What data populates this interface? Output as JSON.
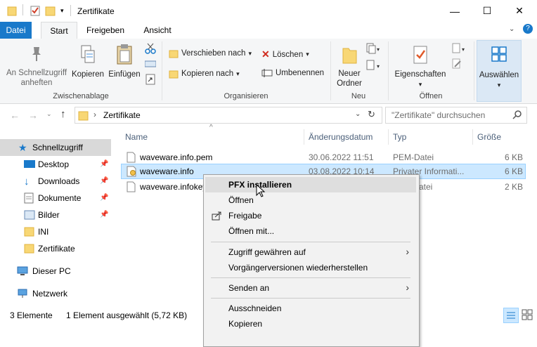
{
  "window": {
    "title": "Zertifikate",
    "minimize_glyph": "—",
    "maximize_glyph": "☐",
    "close_glyph": "✕"
  },
  "tabs": {
    "file": "Datei",
    "start": "Start",
    "share": "Freigeben",
    "view": "Ansicht"
  },
  "ribbon": {
    "quick_access_pin": "An Schnellzugriff anheften",
    "copy": "Kopieren",
    "paste": "Einfügen",
    "clipboard_group": "Zwischenablage",
    "move_to": "Verschieben nach",
    "copy_to": "Kopieren nach",
    "delete": "Löschen",
    "rename": "Umbenennen",
    "organize_group": "Organisieren",
    "new_folder": "Neuer Ordner",
    "new_group": "Neu",
    "properties": "Eigenschaften",
    "open_group": "Öffnen",
    "select": "Auswählen"
  },
  "address": {
    "path": "Zertifikate",
    "search_placeholder": "\"Zertifikate\" durchsuchen"
  },
  "nav": {
    "items": [
      {
        "label": "Schnellzugriff"
      },
      {
        "label": "Desktop"
      },
      {
        "label": "Downloads"
      },
      {
        "label": "Dokumente"
      },
      {
        "label": "Bilder"
      },
      {
        "label": "INI"
      },
      {
        "label": "Zertifikate"
      },
      {
        "label": "Dieser PC"
      },
      {
        "label": "Netzwerk"
      }
    ]
  },
  "columns": {
    "name": "Name",
    "date": "Änderungsdatum",
    "type": "Typ",
    "size": "Größe"
  },
  "files": [
    {
      "name": "waveware.info.pem",
      "date": "30.06.2022 11:51",
      "type": "PEM-Datei",
      "size": "6 KB"
    },
    {
      "name": "waveware.info",
      "date": "03.08.2022 10:14",
      "type": "Privater Informati...",
      "size": "6 KB"
    },
    {
      "name": "waveware.infokey",
      "date": "",
      "type": "atei",
      "size": "2 KB"
    }
  ],
  "status": {
    "count": "3 Elemente",
    "selection": "1 Element ausgewählt (5,72 KB)"
  },
  "context_menu": {
    "install_pfx": "PFX installieren",
    "open": "Öffnen",
    "share": "Freigabe",
    "open_with": "Öffnen mit...",
    "grant_access": "Zugriff gewähren auf",
    "restore_versions": "Vorgängerversionen wiederherstellen",
    "send_to": "Senden an",
    "cut": "Ausschneiden",
    "copy": "Kopieren"
  },
  "colors": {
    "accent": "#1979ca",
    "selection": "#cce8ff",
    "selection_border": "#99d1ff",
    "folder": "#f8d775"
  }
}
